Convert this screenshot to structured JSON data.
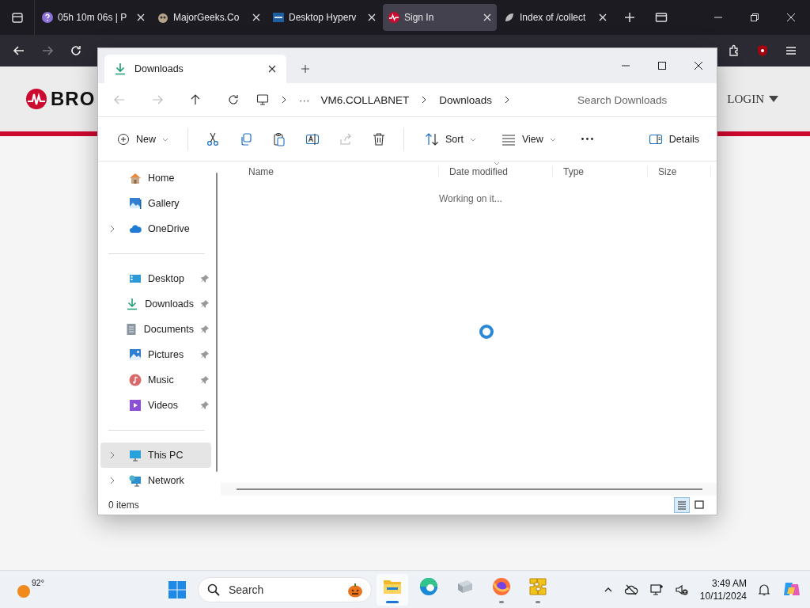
{
  "browser": {
    "tabs": [
      {
        "title": "05h 10m 06s | P",
        "kind": "help",
        "selected": false
      },
      {
        "title": "MajorGeeks.Co",
        "kind": "geek",
        "selected": false
      },
      {
        "title": "Desktop Hyperv",
        "kind": "vmw",
        "selected": false
      },
      {
        "title": "Sign In",
        "kind": "pulse",
        "selected": true
      },
      {
        "title": "Index of /collect",
        "kind": "leaf",
        "selected": false
      }
    ],
    "nav": {
      "forward_disabled": true
    }
  },
  "page": {
    "logo": "BRO",
    "login": "LOGIN"
  },
  "explorer": {
    "tab_title": "Downloads",
    "nav": [
      {
        "kind": "back",
        "disabled": true
      },
      {
        "kind": "forward",
        "disabled": true
      },
      {
        "kind": "up",
        "disabled": false
      },
      {
        "kind": "refresh",
        "disabled": false
      }
    ],
    "breadcrumb_overflow": "···",
    "path": [
      "VM6.COLLABNET",
      "Downloads"
    ],
    "search": {
      "placeholder": "Search Downloads"
    },
    "commands": [
      {
        "kind": "new",
        "label": "New",
        "disabled": false
      },
      {
        "kind": "cut",
        "disabled": false
      },
      {
        "kind": "copy",
        "disabled": false
      },
      {
        "kind": "paste",
        "disabled": false
      },
      {
        "kind": "rename",
        "disabled": false
      },
      {
        "kind": "share",
        "disabled": true
      },
      {
        "kind": "delete",
        "disabled": false
      },
      {
        "kind": "sort",
        "label": "Sort",
        "disabled": false
      },
      {
        "kind": "view",
        "label": "View",
        "disabled": false
      },
      {
        "kind": "more",
        "disabled": false
      },
      {
        "kind": "details",
        "label": "Details",
        "disabled": false
      }
    ],
    "sidebar": [
      [
        {
          "label": "Home",
          "kind": "home",
          "expandable": false,
          "pinned": false,
          "selected": false
        },
        {
          "label": "Gallery",
          "kind": "gallery",
          "expandable": false,
          "pinned": false,
          "selected": false
        },
        {
          "label": "OneDrive",
          "kind": "cloud",
          "expandable": true,
          "pinned": false,
          "selected": false
        }
      ],
      [
        {
          "label": "Desktop",
          "kind": "desktop",
          "expandable": false,
          "pinned": true,
          "selected": false
        },
        {
          "label": "Downloads",
          "kind": "download",
          "expandable": false,
          "pinned": true,
          "selected": false
        },
        {
          "label": "Documents",
          "kind": "document",
          "expandable": false,
          "pinned": true,
          "selected": false
        },
        {
          "label": "Pictures",
          "kind": "pictures",
          "expandable": false,
          "pinned": true,
          "selected": false
        },
        {
          "label": "Music",
          "kind": "music",
          "expandable": false,
          "pinned": true,
          "selected": false
        },
        {
          "label": "Videos",
          "kind": "videos",
          "expandable": false,
          "pinned": true,
          "selected": false
        }
      ],
      [
        {
          "label": "This PC",
          "kind": "pc",
          "expandable": true,
          "pinned": false,
          "selected": true
        },
        {
          "label": "Network",
          "kind": "network",
          "expandable": true,
          "pinned": false,
          "selected": false
        }
      ]
    ],
    "columns": [
      "Name",
      "Date modified",
      "Type",
      "Size"
    ],
    "status": "Working on it...",
    "status_bar": {
      "count": "0 items",
      "views": [
        {
          "kind": "details",
          "selected": true
        },
        {
          "kind": "tiles",
          "selected": false
        }
      ]
    }
  },
  "taskbar": {
    "weather": "92°",
    "search": {
      "placeholder": "Search"
    },
    "apps": [
      {
        "kind": "explorer",
        "active": true,
        "running": true
      },
      {
        "kind": "edge",
        "active": false,
        "running": false
      },
      {
        "kind": "vm",
        "active": false,
        "running": false
      },
      {
        "kind": "firefox",
        "active": false,
        "running": true
      },
      {
        "kind": "puzzle",
        "active": false,
        "running": true
      }
    ],
    "time": "3:49 AM",
    "date": "10/11/2024"
  }
}
